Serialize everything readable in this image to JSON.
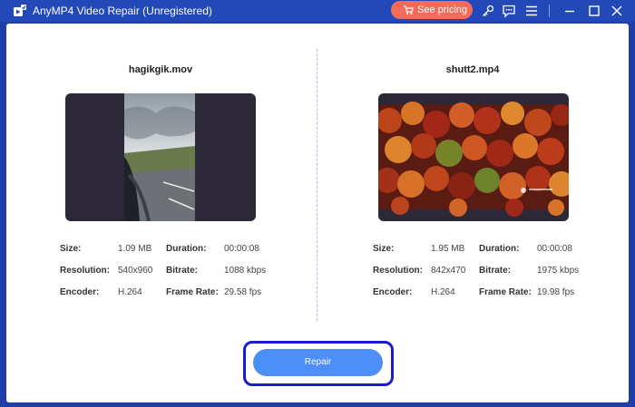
{
  "window": {
    "title": "AnyMP4 Video Repair (Unregistered)",
    "pricing_label": "See pricing",
    "icons": [
      "app-logo-icon",
      "cart-icon",
      "key-icon",
      "feedback-icon",
      "menu-icon",
      "minimize-icon",
      "maximize-icon",
      "close-icon"
    ]
  },
  "left": {
    "filename": "hagikgik.mov",
    "size_label": "Size:",
    "size": "1.09 MB",
    "duration_label": "Duration:",
    "duration": "00:00:08",
    "resolution_label": "Resolution:",
    "resolution": "540x960",
    "bitrate_label": "Bitrate:",
    "bitrate": "1088 kbps",
    "encoder_label": "Encoder:",
    "encoder": "H.264",
    "framerate_label": "Frame Rate:",
    "framerate": "29.58 fps"
  },
  "right": {
    "filename": "shutt2.mp4",
    "size_label": "Size:",
    "size": "1.95 MB",
    "duration_label": "Duration:",
    "duration": "00:00:08",
    "resolution_label": "Resolution:",
    "resolution": "842x470",
    "bitrate_label": "Bitrate:",
    "bitrate": "1975 kbps",
    "encoder_label": "Encoder:",
    "encoder": "H.264",
    "framerate_label": "Frame Rate:",
    "framerate": "19.98 fps"
  },
  "actions": {
    "repair_label": "Repair"
  },
  "colors": {
    "titlebar": "#2348b8",
    "accent": "#4d8ef8",
    "pricing": "#f26b5b",
    "focus_ring": "#1a1ad0"
  }
}
